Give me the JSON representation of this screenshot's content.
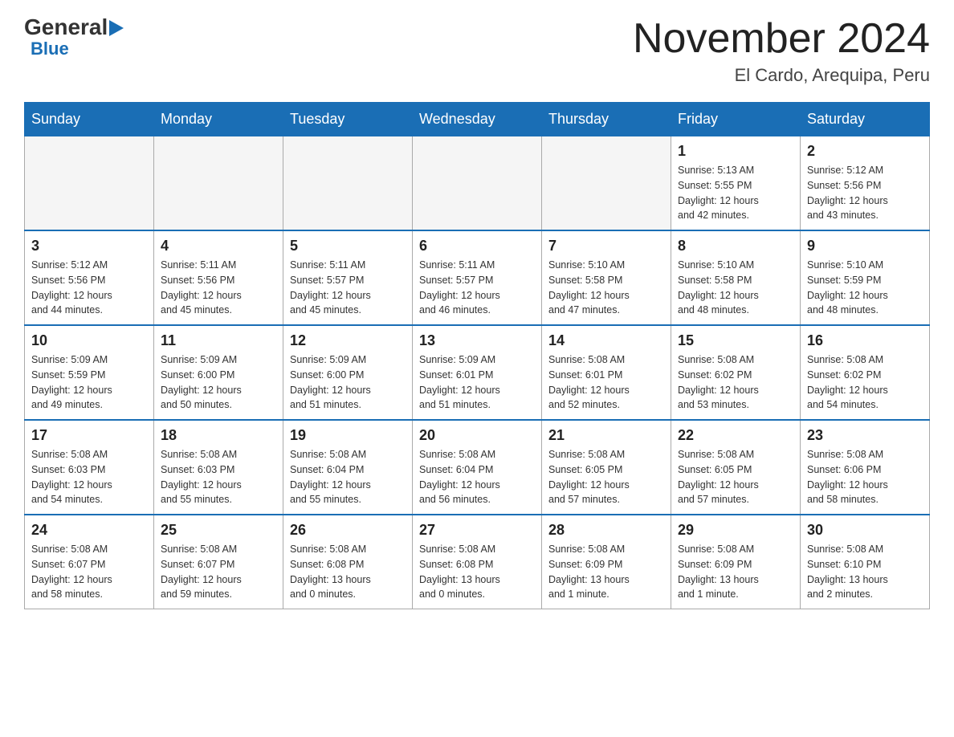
{
  "header": {
    "logo": {
      "general": "General",
      "blue": "Blue",
      "arrow": "▶"
    },
    "title": "November 2024",
    "location": "El Cardo, Arequipa, Peru"
  },
  "days_of_week": [
    "Sunday",
    "Monday",
    "Tuesday",
    "Wednesday",
    "Thursday",
    "Friday",
    "Saturday"
  ],
  "weeks": [
    [
      {
        "day": "",
        "info": ""
      },
      {
        "day": "",
        "info": ""
      },
      {
        "day": "",
        "info": ""
      },
      {
        "day": "",
        "info": ""
      },
      {
        "day": "",
        "info": ""
      },
      {
        "day": "1",
        "info": "Sunrise: 5:13 AM\nSunset: 5:55 PM\nDaylight: 12 hours\nand 42 minutes."
      },
      {
        "day": "2",
        "info": "Sunrise: 5:12 AM\nSunset: 5:56 PM\nDaylight: 12 hours\nand 43 minutes."
      }
    ],
    [
      {
        "day": "3",
        "info": "Sunrise: 5:12 AM\nSunset: 5:56 PM\nDaylight: 12 hours\nand 44 minutes."
      },
      {
        "day": "4",
        "info": "Sunrise: 5:11 AM\nSunset: 5:56 PM\nDaylight: 12 hours\nand 45 minutes."
      },
      {
        "day": "5",
        "info": "Sunrise: 5:11 AM\nSunset: 5:57 PM\nDaylight: 12 hours\nand 45 minutes."
      },
      {
        "day": "6",
        "info": "Sunrise: 5:11 AM\nSunset: 5:57 PM\nDaylight: 12 hours\nand 46 minutes."
      },
      {
        "day": "7",
        "info": "Sunrise: 5:10 AM\nSunset: 5:58 PM\nDaylight: 12 hours\nand 47 minutes."
      },
      {
        "day": "8",
        "info": "Sunrise: 5:10 AM\nSunset: 5:58 PM\nDaylight: 12 hours\nand 48 minutes."
      },
      {
        "day": "9",
        "info": "Sunrise: 5:10 AM\nSunset: 5:59 PM\nDaylight: 12 hours\nand 48 minutes."
      }
    ],
    [
      {
        "day": "10",
        "info": "Sunrise: 5:09 AM\nSunset: 5:59 PM\nDaylight: 12 hours\nand 49 minutes."
      },
      {
        "day": "11",
        "info": "Sunrise: 5:09 AM\nSunset: 6:00 PM\nDaylight: 12 hours\nand 50 minutes."
      },
      {
        "day": "12",
        "info": "Sunrise: 5:09 AM\nSunset: 6:00 PM\nDaylight: 12 hours\nand 51 minutes."
      },
      {
        "day": "13",
        "info": "Sunrise: 5:09 AM\nSunset: 6:01 PM\nDaylight: 12 hours\nand 51 minutes."
      },
      {
        "day": "14",
        "info": "Sunrise: 5:08 AM\nSunset: 6:01 PM\nDaylight: 12 hours\nand 52 minutes."
      },
      {
        "day": "15",
        "info": "Sunrise: 5:08 AM\nSunset: 6:02 PM\nDaylight: 12 hours\nand 53 minutes."
      },
      {
        "day": "16",
        "info": "Sunrise: 5:08 AM\nSunset: 6:02 PM\nDaylight: 12 hours\nand 54 minutes."
      }
    ],
    [
      {
        "day": "17",
        "info": "Sunrise: 5:08 AM\nSunset: 6:03 PM\nDaylight: 12 hours\nand 54 minutes."
      },
      {
        "day": "18",
        "info": "Sunrise: 5:08 AM\nSunset: 6:03 PM\nDaylight: 12 hours\nand 55 minutes."
      },
      {
        "day": "19",
        "info": "Sunrise: 5:08 AM\nSunset: 6:04 PM\nDaylight: 12 hours\nand 55 minutes."
      },
      {
        "day": "20",
        "info": "Sunrise: 5:08 AM\nSunset: 6:04 PM\nDaylight: 12 hours\nand 56 minutes."
      },
      {
        "day": "21",
        "info": "Sunrise: 5:08 AM\nSunset: 6:05 PM\nDaylight: 12 hours\nand 57 minutes."
      },
      {
        "day": "22",
        "info": "Sunrise: 5:08 AM\nSunset: 6:05 PM\nDaylight: 12 hours\nand 57 minutes."
      },
      {
        "day": "23",
        "info": "Sunrise: 5:08 AM\nSunset: 6:06 PM\nDaylight: 12 hours\nand 58 minutes."
      }
    ],
    [
      {
        "day": "24",
        "info": "Sunrise: 5:08 AM\nSunset: 6:07 PM\nDaylight: 12 hours\nand 58 minutes."
      },
      {
        "day": "25",
        "info": "Sunrise: 5:08 AM\nSunset: 6:07 PM\nDaylight: 12 hours\nand 59 minutes."
      },
      {
        "day": "26",
        "info": "Sunrise: 5:08 AM\nSunset: 6:08 PM\nDaylight: 13 hours\nand 0 minutes."
      },
      {
        "day": "27",
        "info": "Sunrise: 5:08 AM\nSunset: 6:08 PM\nDaylight: 13 hours\nand 0 minutes."
      },
      {
        "day": "28",
        "info": "Sunrise: 5:08 AM\nSunset: 6:09 PM\nDaylight: 13 hours\nand 1 minute."
      },
      {
        "day": "29",
        "info": "Sunrise: 5:08 AM\nSunset: 6:09 PM\nDaylight: 13 hours\nand 1 minute."
      },
      {
        "day": "30",
        "info": "Sunrise: 5:08 AM\nSunset: 6:10 PM\nDaylight: 13 hours\nand 2 minutes."
      }
    ]
  ]
}
